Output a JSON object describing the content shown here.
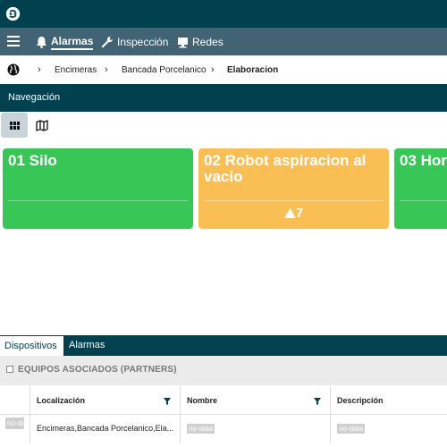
{
  "nav": {
    "items": [
      {
        "label": "Alarmas",
        "icon": "bell-icon",
        "active": true
      },
      {
        "label": "Inspección",
        "icon": "wrench-icon",
        "active": false
      },
      {
        "label": "Redes",
        "icon": "monitor-icon",
        "active": false
      }
    ]
  },
  "breadcrumb": [
    "Encimeras",
    "Bancada Porcelanico",
    "Elaboracion"
  ],
  "section_title": "Navegación",
  "cards": [
    {
      "title": "01 Silo",
      "color": "#38c656",
      "alarm_count": ""
    },
    {
      "title": "02 Robot aspiracion al vacio",
      "color": "#f9bf55",
      "alarm_count": "7"
    },
    {
      "title": "03 Hor",
      "color": "#38c656",
      "alarm_count": ""
    }
  ],
  "tabs": [
    "Dispositivos",
    "Alarmas"
  ],
  "partners_label": "EQUIPOS ASOCIADOS (PARTNERS)",
  "table": {
    "columns": [
      "Localización",
      "Nombre",
      "Descripción"
    ],
    "row": {
      "tag": "no-da...",
      "localizacion": "Encimeras,Bancada Porcelanico,Ela...",
      "nombre": "no-data",
      "descripcion": "no-data"
    }
  },
  "colors": {
    "header_dark": "#00404f",
    "nav_bar": "#416374",
    "status_ok": "#38c656",
    "status_warning": "#f9bf55"
  }
}
